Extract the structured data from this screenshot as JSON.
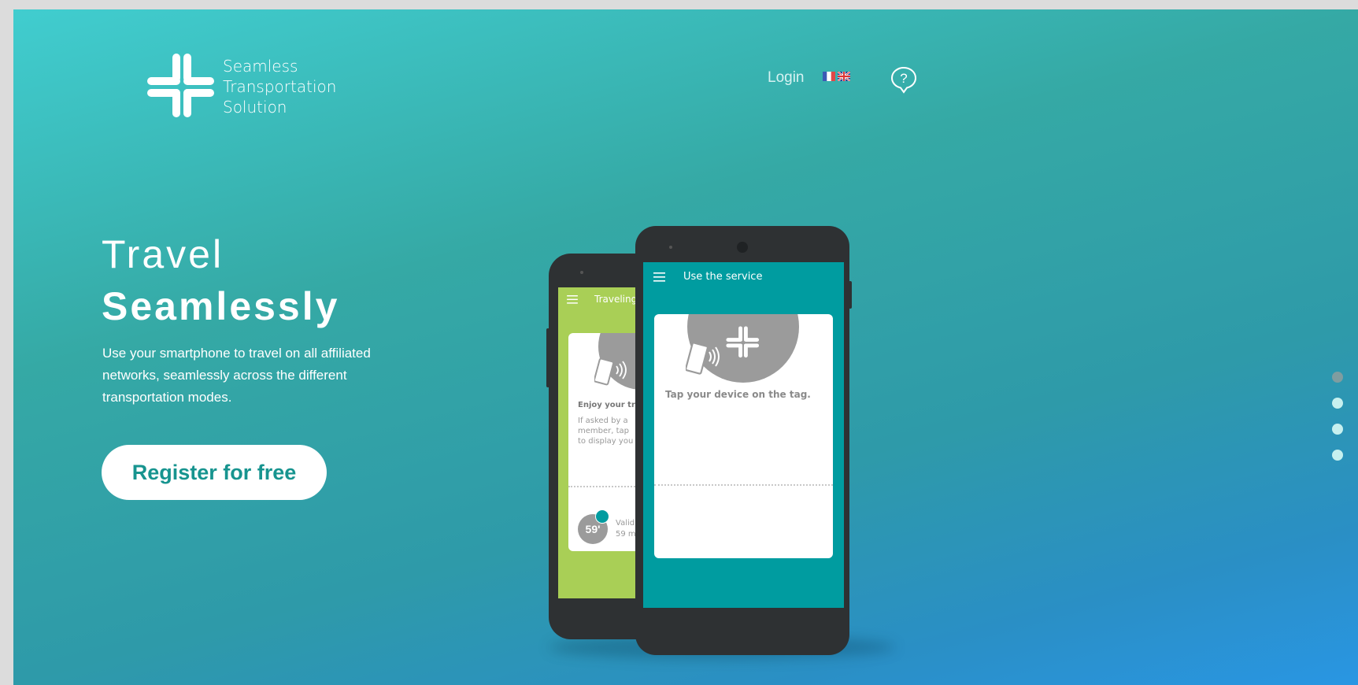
{
  "logo": {
    "line1": "Seamless",
    "line2": "Transportation",
    "line3": "Solution"
  },
  "nav": {
    "login": "Login",
    "flags": [
      "french-flag-icon",
      "uk-flag-icon"
    ],
    "help_icon": "question-bubble-icon",
    "help_label": "?"
  },
  "hero": {
    "title_line1": "Travel",
    "title_line2": "Seamlessly",
    "description": "Use your smartphone to travel on all affiliated networks, seamlessly across the different transportation modes.",
    "cta_label": "Register for free"
  },
  "phone_back": {
    "header": "Traveling",
    "card_heading": "Enjoy your tra",
    "card_line1": "If asked by a",
    "card_line2": "member, tap",
    "card_line3": "to display you",
    "badge": "59'",
    "valid_line1": "Valid",
    "valid_line2": "59 m"
  },
  "phone_front": {
    "header": "Use the service",
    "instruction": "Tap your device on the tag."
  },
  "pager": {
    "active_index": 0,
    "count": 4
  },
  "colors": {
    "cta_text": "#17948f",
    "front_screen": "#009ca0",
    "back_screen": "#a9cf56",
    "pager_active": "#7f9da0",
    "pager_inactive": "#c7f0ef"
  }
}
